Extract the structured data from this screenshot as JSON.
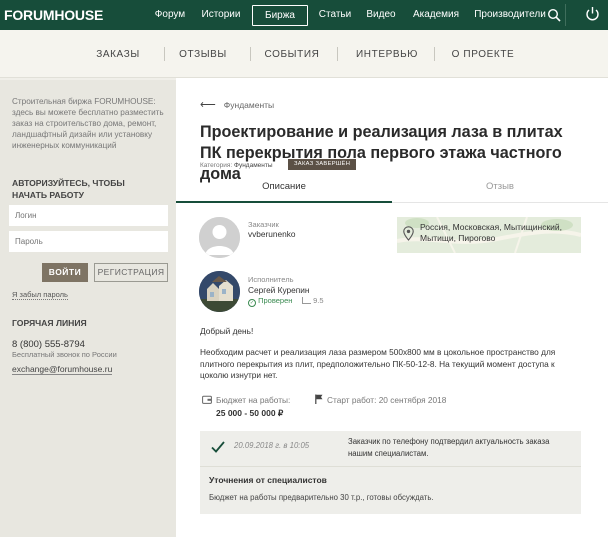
{
  "header": {
    "logo": "FORUMHOUSE",
    "nav": [
      "Форум",
      "Истории",
      "Биржа",
      "Статьи",
      "Видео",
      "Академия",
      "Производители"
    ],
    "active_nav": "Биржа",
    "icons": [
      "search-icon",
      "power-icon"
    ]
  },
  "subnav": [
    "ЗАКАЗЫ",
    "ОТЗЫВЫ",
    "СОБЫТИЯ",
    "ИНТЕРВЬЮ",
    "О ПРОЕКТЕ"
  ],
  "sidebar": {
    "intro": "Строительная биржа FORUMHOUSE: здесь вы можете бесплатно разместить заказ на строительство дома, ремонт, ландшафтный дизайн или установку инженерных коммуникаций",
    "auth_title": "АВТОРИЗУЙТЕСЬ, ЧТОБЫ НАЧАТЬ РАБОТУ",
    "login_placeholder": "Логин",
    "password_placeholder": "Пароль",
    "login_button": "ВОЙТИ",
    "register_button": "РЕГИСТРАЦИЯ",
    "forgot": "Я забыл пароль",
    "hotline_title": "ГОРЯЧАЯ ЛИНИЯ",
    "phone": "8 (800) 555-8794",
    "phone_note": "Бесплатный звонок по России",
    "email": "exchange@forumhouse.ru"
  },
  "order": {
    "back_label": "Фундаменты",
    "title": "Проектирование и реализация лаза в плитах ПК перекрытия пола первого этажа частного дома",
    "category_label": "Категория:",
    "category": "Фундаменты",
    "status": "ЗАКАЗ ЗАВЕРШЁН",
    "tabs": [
      "Описание",
      "Отзыв"
    ],
    "customer_role": "Заказчик",
    "customer_name": "vvberunenko",
    "location": "Россия, Московская, Мытищинский, Мытищи, Пирогово",
    "executor_role": "Исполнитель",
    "executor_name": "Сергей Курепин",
    "verified": "Проверен",
    "rating": "9.5",
    "greeting": "Добрый день!",
    "description": "Необходим расчет и реализация лаза размером 500х800 мм в цокольное пространство для плитного перекрытия из плит, предположительно ПК-50-12-8. На текущий момент доступа к цоколю изнутри нет.",
    "budget_label": "Бюджет на работы:",
    "budget_value": "25 000 - 50 000 ₽",
    "start_label": "Старт работ:",
    "start_value": "20 сентября 2018",
    "history_date": "20.09.2018 г. в 10:05",
    "history_text": "Заказчик по телефону подтвердил актуальность заказа нашим специалистам.",
    "refine_title": "Уточнения от специалистов",
    "refine_text": "Бюджет на работы предварительно 30 т.р., готовы обсуждать."
  },
  "colors": {
    "header_bg": "#174d3a",
    "status_badge": "#5b5045",
    "login_button": "#7e7464",
    "verified": "#3a8a50"
  }
}
